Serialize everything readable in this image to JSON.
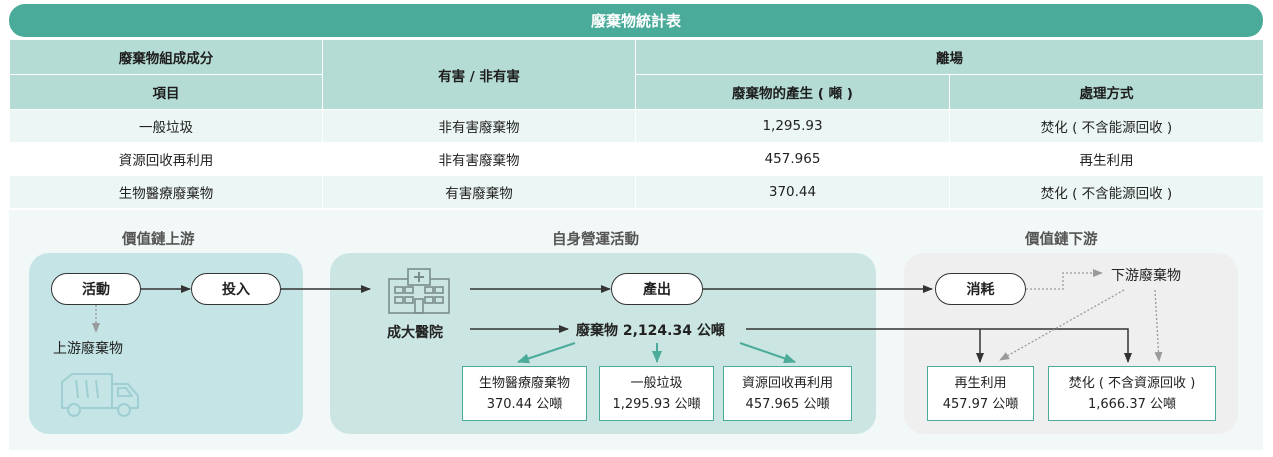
{
  "table": {
    "title": "廢棄物統計表",
    "headers": {
      "composition": "廢棄物組成成分",
      "hazard": "有害 / 非有害",
      "offsite": "離場",
      "item": "項目",
      "generation": "廢棄物的產生 ( 噸 )",
      "treatment": "處理方式"
    },
    "rows": [
      {
        "item": "一般垃圾",
        "hazard": "非有害廢棄物",
        "amount": "1,295.93",
        "treatment": "焚化 ( 不含能源回收 )"
      },
      {
        "item": "資源回收再利用",
        "hazard": "非有害廢棄物",
        "amount": "457.965",
        "treatment": "再生利用"
      },
      {
        "item": "生物醫療廢棄物",
        "hazard": "有害廢棄物",
        "amount": "370.44",
        "treatment": "焚化 ( 不含能源回收 )"
      }
    ]
  },
  "diagram": {
    "sections": {
      "upstream": "價值鏈上游",
      "operations": "自身營運活動",
      "downstream": "價值鏈下游"
    },
    "upstream": {
      "activity": "活動",
      "input": "投入",
      "waste_label": "上游廢棄物",
      "truck_icon": "garbage-truck-icon"
    },
    "operations": {
      "hospital_icon": "hospital-icon",
      "hospital_label": "成大醫院",
      "output": "產出",
      "waste_total": "廢棄物 2,124.34 公噸",
      "breakdown": [
        {
          "name": "生物醫療廢棄物",
          "amount": "370.44 公噸"
        },
        {
          "name": "一般垃圾",
          "amount": "1,295.93 公噸"
        },
        {
          "name": "資源回收再利用",
          "amount": "457.965 公噸"
        }
      ]
    },
    "downstream": {
      "consumption": "消耗",
      "waste_label": "下游廢棄物",
      "outcomes": [
        {
          "name": "再生利用",
          "amount": "457.97 公噸"
        },
        {
          "name": "焚化 ( 不含資源回收 )",
          "amount": "1,666.37 公噸"
        }
      ]
    },
    "colors": {
      "teal": "#4aab9a",
      "arrow_dark": "#333333",
      "arrow_gray": "#9a9a9a"
    }
  }
}
